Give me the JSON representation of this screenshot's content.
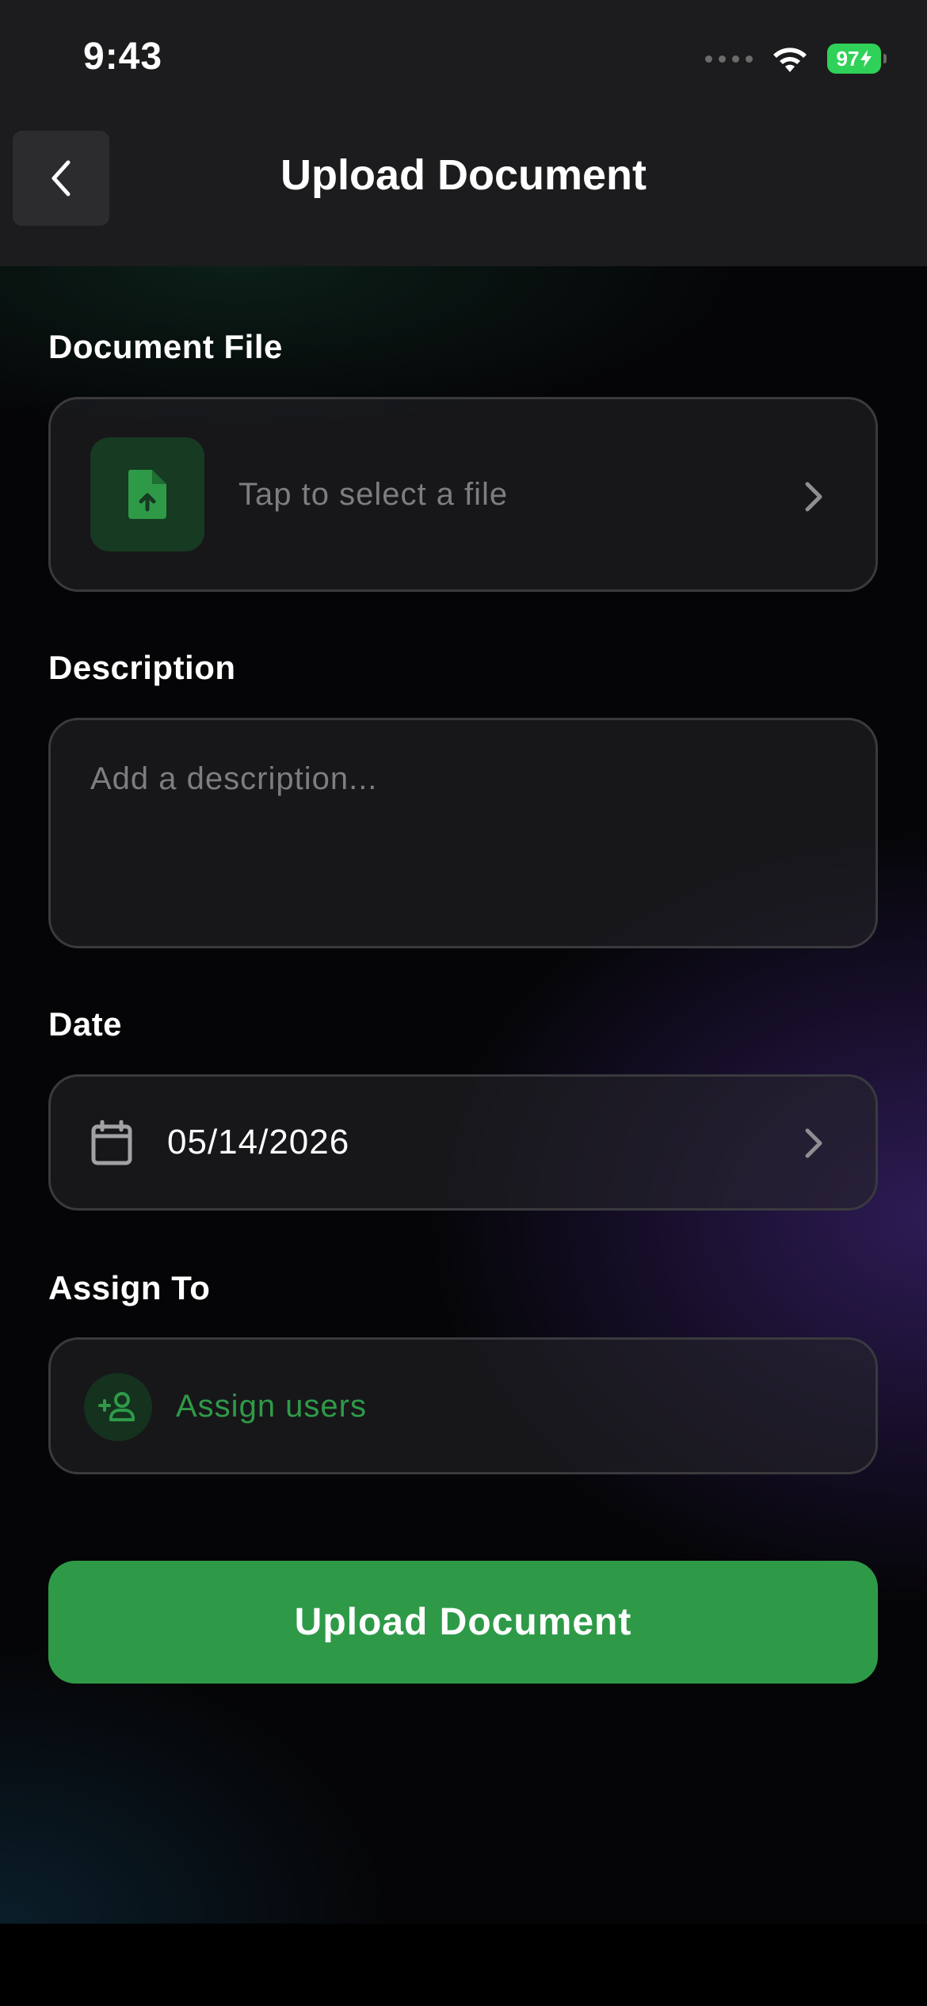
{
  "status_bar": {
    "time": "9:43",
    "battery": "97",
    "icons": [
      "signal-dots-icon",
      "wifi-icon",
      "battery-charging-icon"
    ]
  },
  "header": {
    "title": "Upload Document",
    "back_icon": "chevron-left-icon"
  },
  "document_file": {
    "label": "Document File",
    "placeholder": "Tap to select a file",
    "icon": "file-upload-icon"
  },
  "description": {
    "label": "Description",
    "placeholder": "Add a description..."
  },
  "date": {
    "label": "Date",
    "value": "05/14/2026",
    "icon": "calendar-icon"
  },
  "assign_to": {
    "label": "Assign To",
    "button_label": "Assign users",
    "icon": "add-user-icon"
  },
  "submit": {
    "label": "Upload Document"
  },
  "colors": {
    "accent_green": "#2e9a48",
    "background": "#050507",
    "header_bg": "#1c1c1e"
  }
}
